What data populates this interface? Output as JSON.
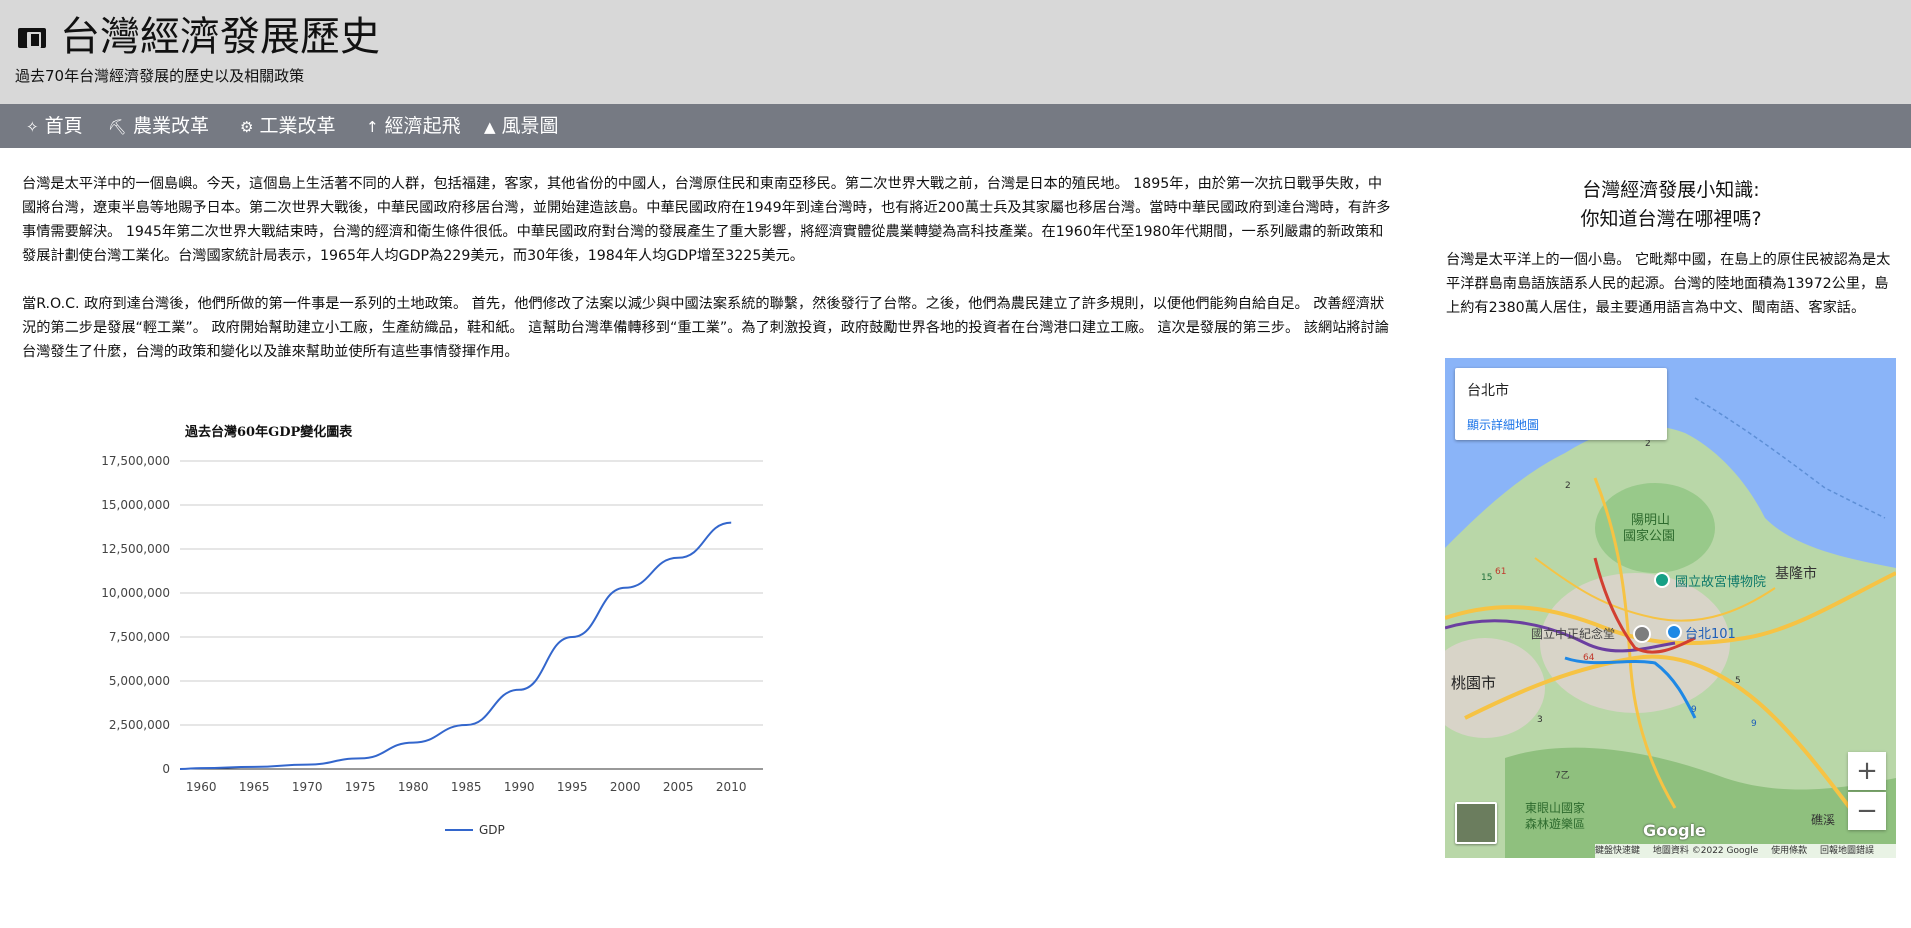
{
  "header": {
    "title": "台灣經濟發展歷史",
    "subtitle": "過去70年台灣經濟發展的歷史以及相關政策",
    "logo_icon": "book-icon"
  },
  "nav": {
    "items": [
      {
        "label": "首頁",
        "icon": "feather-icon"
      },
      {
        "label": "農業改革",
        "icon": "tractor-icon"
      },
      {
        "label": "工業改革",
        "icon": "factory-icon"
      },
      {
        "label": "經濟起飛",
        "icon": "rocket-icon"
      },
      {
        "label": "風景圖",
        "icon": "landscape-icon"
      }
    ]
  },
  "main": {
    "paragraphs": [
      "台灣是太平洋中的一個島嶼。今天，這個島上生活著不同的人群，包括福建，客家，其他省份的中國人，台灣原住民和東南亞移民。第二次世界大戰之前，台灣是日本的殖民地。 1895年，由於第一次抗日戰爭失敗，中國將台灣，遼東半島等地賜予日本。第二次世界大戰後，中華民國政府移居台灣，並開始建造該島。中華民國政府在1949年到達台灣時，也有將近200萬士兵及其家屬也移居台灣。當時中華民國政府到達台灣時，有許多事情需要解決。 1945年第二次世界大戰結束時，台灣的經濟和衛生條件很低。中華民國政府對台灣的發展產生了重大影響，將經濟實體從農業轉變為高科技產業。在1960年代至1980年代期間，一系列嚴肅的新政策和發展計劃使台灣工業化。台灣國家統計局表示，1965年人均GDP為229美元，而30年後，1984年人均GDP增至3225美元。",
      "當R.O.C. 政府到達台灣後，他們所做的第一件事是一系列的土地政策。 首先，他們修改了法案以減少與中國法案系統的聯繫，然後發行了台幣。之後，他們為農民建立了許多規則，以便他們能夠自給自足。 改善經濟狀況的第二步是發展“輕工業”。 政府開始幫助建立小工廠，生產紡織品，鞋和紙。 這幫助台灣準備轉移到“重工業”。為了刺激投資，政府鼓勵世界各地的投資者在台灣港口建立工廠。 這次是發展的第三步。 該網站將討論台灣發生了什麼，台灣的政策和變化以及誰來幫助並使所有這些事情發揮作用。"
    ]
  },
  "chart_data": {
    "type": "line",
    "title": "過去台灣60年GDP變化圖表",
    "xlabel": "",
    "ylabel": "",
    "x": [
      1958,
      1960,
      1965,
      1970,
      1975,
      1980,
      1985,
      1990,
      1995,
      2000,
      2005,
      2010
    ],
    "x_ticks": [
      "1960",
      "1965",
      "1970",
      "1975",
      "1980",
      "1985",
      "1990",
      "1995",
      "2000",
      "2005",
      "2010"
    ],
    "y_ticks": [
      "0",
      "2,500,000",
      "5,000,000",
      "7,500,000",
      "10,000,000",
      "12,500,000",
      "15,000,000",
      "17,500,000"
    ],
    "ylim": [
      0,
      17500000
    ],
    "xlim": [
      1958,
      2013
    ],
    "series": [
      {
        "name": "GDP",
        "values": [
          0,
          50000,
          120000,
          250000,
          600000,
          1500000,
          2500000,
          4500000,
          7500000,
          10300000,
          12000000,
          14000000
        ],
        "color": "#3366cc"
      }
    ],
    "legend": "bottom",
    "grid": true
  },
  "aside": {
    "title_line1": "台灣經濟發展小知識:",
    "title_line2": "你知道台灣在哪裡嗎?",
    "text": "台灣是太平洋上的一個小島。 它毗鄰中國，在島上的原住民被認為是太平洋群島南島語族語系人民的起源。台灣的陸地面積為13972公里，島上約有2380萬人居住，最主要通用語言為中文、閩南語、客家話。"
  },
  "map": {
    "place_name": "台北市",
    "view_link": "顯示詳細地圖",
    "labels": [
      "陽明山",
      "國家公園",
      "基隆市",
      "國立故宮博物院",
      "國立中正紀念堂",
      "台北101",
      "桃園市",
      "東眼山國家",
      "森林遊樂區",
      "礁溪"
    ],
    "road_numbers": [
      "2",
      "2",
      "61",
      "15",
      "64",
      "5",
      "3",
      "9",
      "9",
      "7乙"
    ],
    "zoom_in": "+",
    "zoom_out": "−",
    "logo": "Google",
    "footer": [
      "鍵盤快速鍵",
      "地圖資料 ©2022 Google",
      "使用條款",
      "回報地圖錯誤"
    ],
    "colors": {
      "water": "#8ab4f8",
      "land": "#b9d7a8",
      "urban": "#d8d4c8",
      "road": "#f6c344",
      "rail": "#d23f31"
    }
  }
}
